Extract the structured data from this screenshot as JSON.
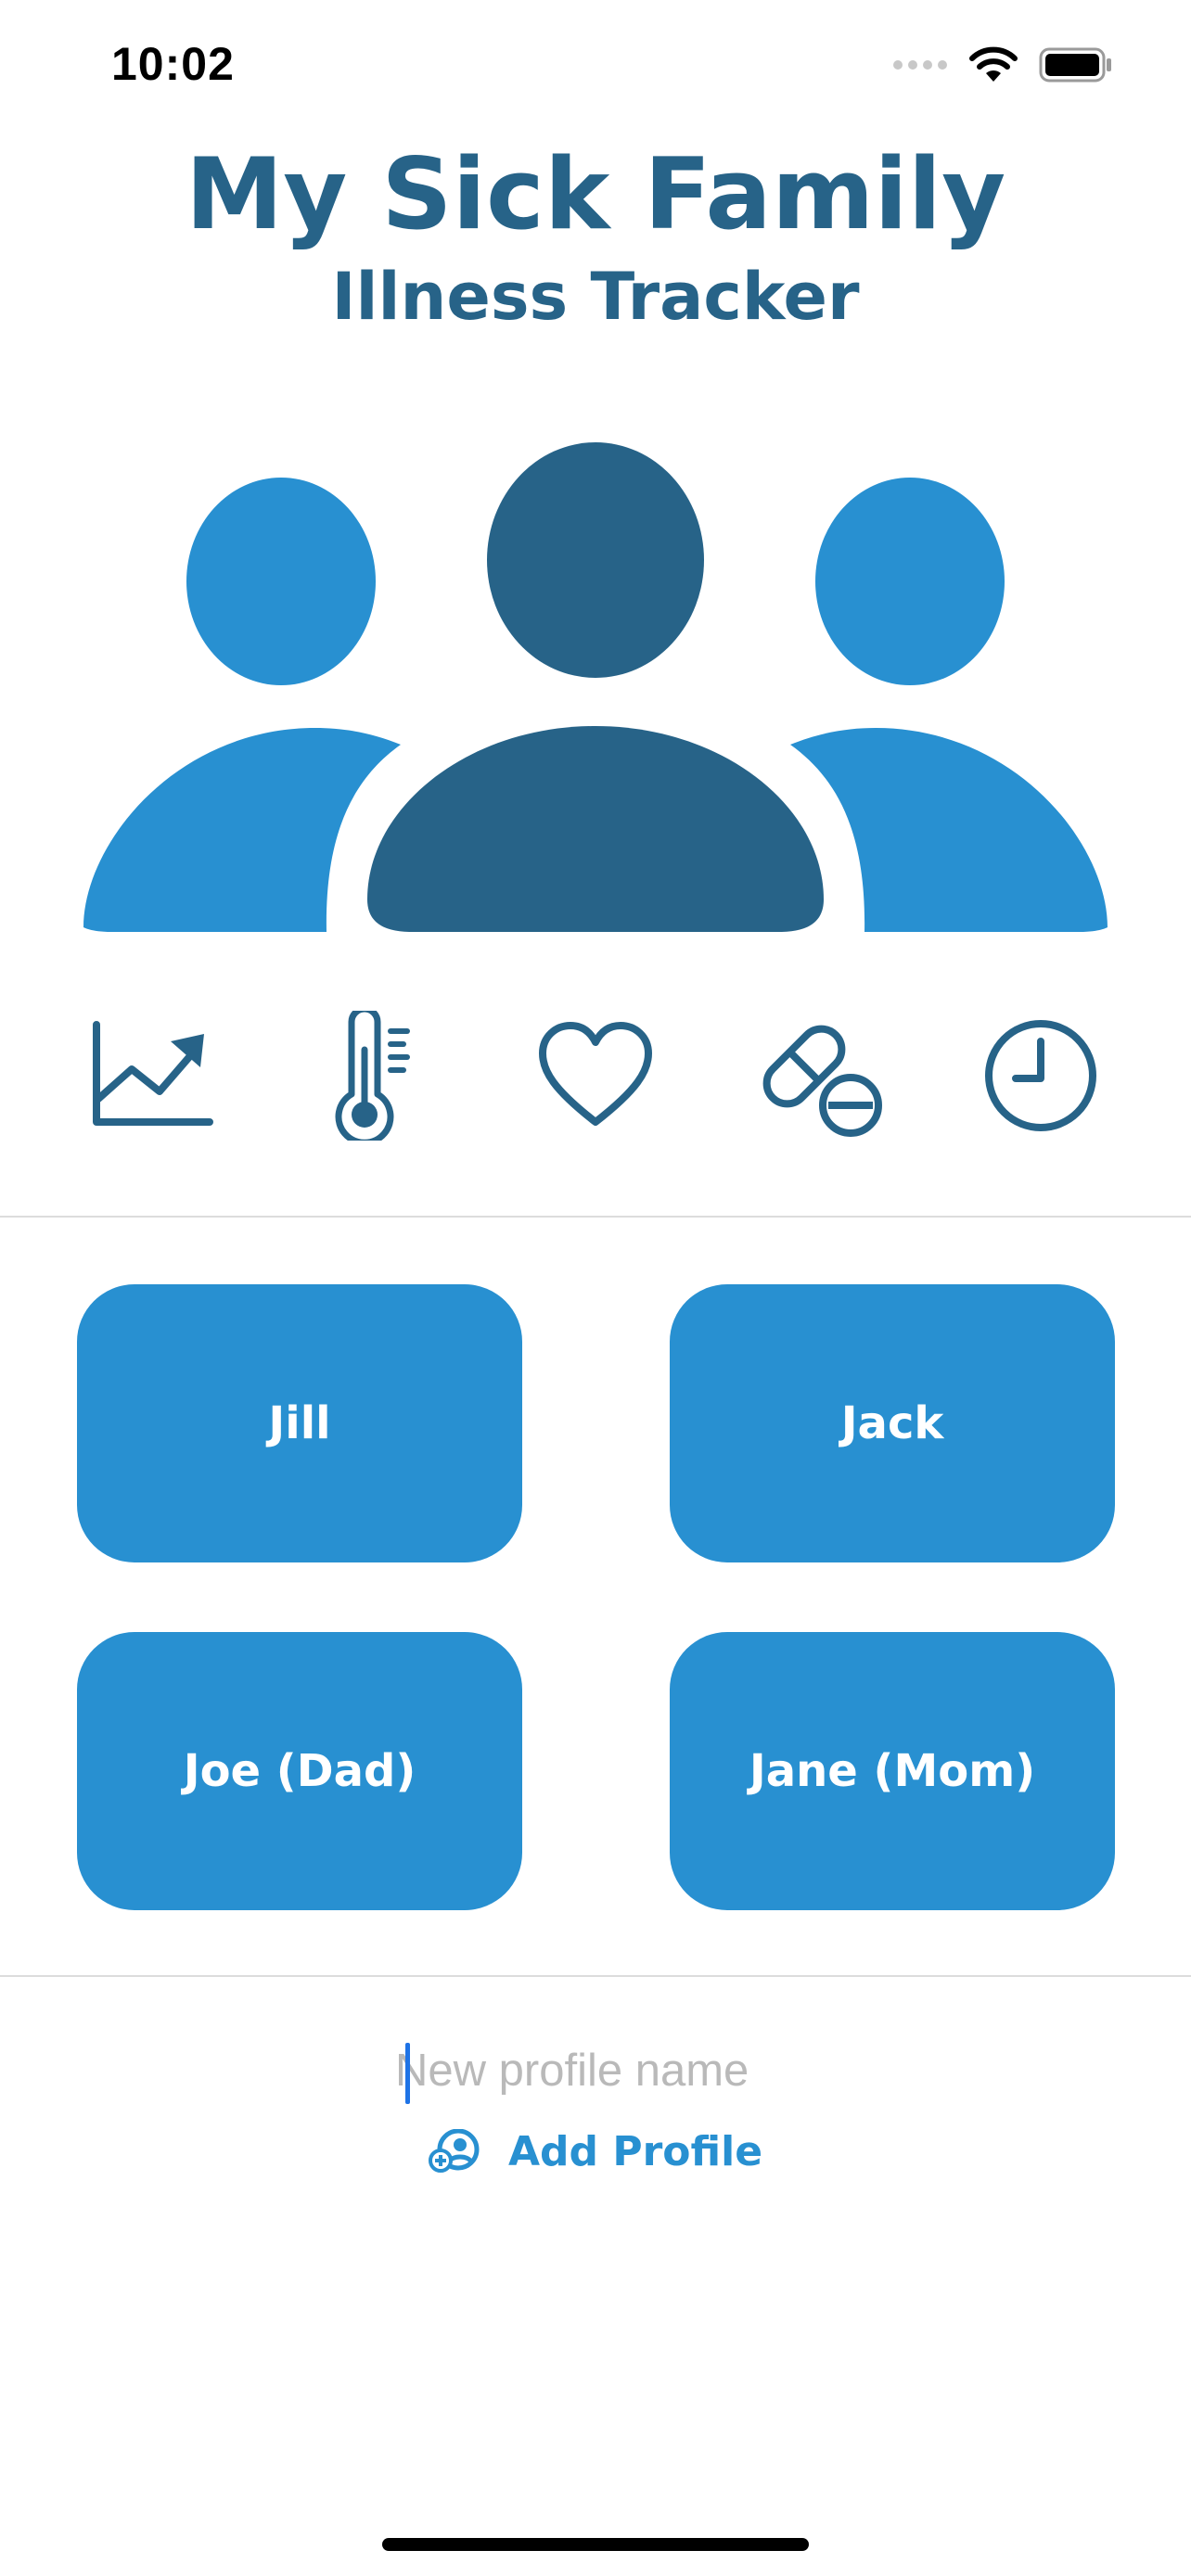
{
  "status_bar": {
    "time": "10:02",
    "icons": [
      "signal-dots-icon",
      "wifi-icon",
      "battery-icon"
    ]
  },
  "header": {
    "title": "My Sick Family",
    "subtitle": "Illness Tracker"
  },
  "hero_icon": "family-icon",
  "features": [
    {
      "icon": "chart-trend-icon"
    },
    {
      "icon": "thermometer-icon"
    },
    {
      "icon": "heart-icon"
    },
    {
      "icon": "pill-icon"
    },
    {
      "icon": "clock-icon"
    }
  ],
  "profiles": [
    {
      "name": "Jill"
    },
    {
      "name": "Jack"
    },
    {
      "name": "Joe (Dad)"
    },
    {
      "name": "Jane (Mom)"
    }
  ],
  "new_profile": {
    "placeholder": "New profile name",
    "value": ""
  },
  "add_profile": {
    "label": "Add Profile",
    "icon": "add-person-icon"
  },
  "colors": {
    "primary": "#2890d1",
    "dark": "#276388",
    "divider": "#dcdcdc"
  }
}
